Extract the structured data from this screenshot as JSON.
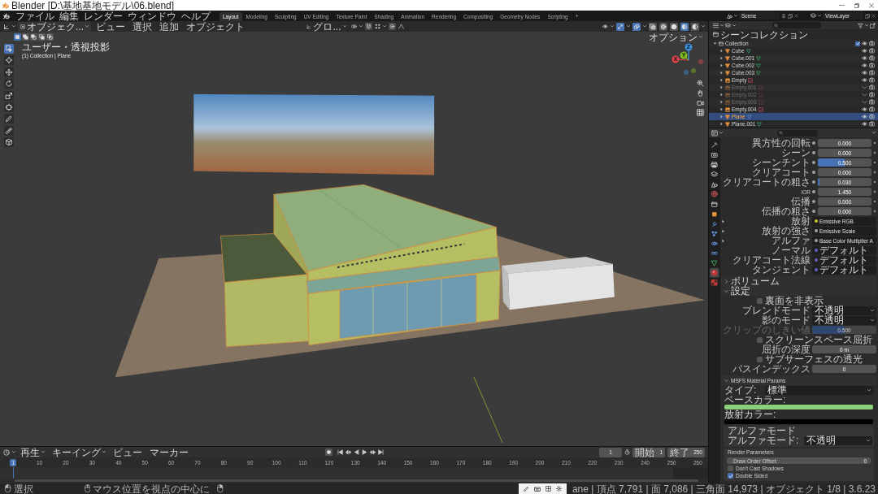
{
  "window": {
    "title": "Blender [D:\\基地基地モデル\\06.blend]"
  },
  "menu": [
    "ファイル",
    "編集",
    "レンダー",
    "ウィンドウ",
    "ヘルプ"
  ],
  "workspaces": [
    {
      "label": "Layout",
      "selected": true
    },
    {
      "label": "Modeling",
      "selected": false
    },
    {
      "label": "Sculpting",
      "selected": false
    },
    {
      "label": "UV Editing",
      "selected": false
    },
    {
      "label": "Texture Paint",
      "selected": false
    },
    {
      "label": "Shading",
      "selected": false
    },
    {
      "label": "Animation",
      "selected": false
    },
    {
      "label": "Rendering",
      "selected": false
    },
    {
      "label": "Compositing",
      "selected": false
    },
    {
      "label": "Geometry Nodes",
      "selected": false
    },
    {
      "label": "Scripting",
      "selected": false
    }
  ],
  "add_workspace": "+",
  "scene": {
    "scene_name": "Scene",
    "view_layer": "ViewLayer"
  },
  "viewport": {
    "mode": "オブジェク...",
    "menus": [
      "ビュー",
      "選択",
      "追加",
      "オブジェクト"
    ],
    "orientation": "グロ...",
    "toggles": [
      {
        "kind": "gizmo",
        "on": true
      },
      {
        "kind": "overlay",
        "on": true
      },
      {
        "kind": "xray",
        "on": false
      }
    ],
    "shading": [
      {
        "kind": "wireframe",
        "selected": false
      },
      {
        "kind": "solid",
        "selected": false
      },
      {
        "kind": "material",
        "selected": true
      },
      {
        "kind": "rendered",
        "selected": false
      }
    ],
    "selection_modes": [
      {
        "kind": "set",
        "selected": true
      },
      {
        "kind": "extend",
        "selected": false
      },
      {
        "kind": "subtract",
        "selected": false
      },
      {
        "kind": "invert",
        "selected": false
      },
      {
        "kind": "intersect",
        "selected": false
      }
    ],
    "options": "オプション",
    "view_name": "ユーザー・透視投影",
    "context": "(1) Collection | Plane",
    "tools": [
      {
        "kind": "select",
        "selected": true
      },
      {
        "kind": "cursor",
        "selected": false
      },
      {
        "kind": "move",
        "selected": false
      },
      {
        "kind": "rotate",
        "selected": false
      },
      {
        "kind": "scale",
        "selected": false
      },
      {
        "kind": "transform",
        "selected": false
      },
      {
        "kind": "annotate",
        "selected": false
      },
      {
        "kind": "measure",
        "selected": false
      },
      {
        "kind": "add_cube",
        "selected": false
      }
    ],
    "gizmo": [
      {
        "label": "X",
        "color": "#e0434f"
      },
      {
        "label": "Y",
        "color": "#7fb81e"
      },
      {
        "label": "Z",
        "color": "#3d8fe0"
      }
    ]
  },
  "outliner": {
    "root": "シーンコレクション",
    "items": [
      {
        "name": "Collection",
        "kind": "collection",
        "expanded": true,
        "checked": true,
        "selected": false,
        "visible": true,
        "children": [
          {
            "name": "Cube",
            "kind": "mesh",
            "expanded": false,
            "selected": false,
            "visible": true
          },
          {
            "name": "Cube.001",
            "kind": "mesh",
            "expanded": false,
            "selected": false,
            "visible": true
          },
          {
            "name": "Cube.002",
            "kind": "mesh",
            "expanded": false,
            "selected": false,
            "visible": true
          },
          {
            "name": "Cube.003",
            "kind": "mesh",
            "expanded": false,
            "selected": false,
            "visible": true
          },
          {
            "name": "Empty",
            "kind": "empty",
            "expanded": false,
            "selected": false,
            "visible": true
          },
          {
            "name": "Empty.001",
            "kind": "empty",
            "expanded": false,
            "selected": false,
            "visible": false
          },
          {
            "name": "Empty.002",
            "kind": "empty",
            "expanded": false,
            "selected": false,
            "visible": false
          },
          {
            "name": "Empty.003",
            "kind": "empty",
            "expanded": false,
            "selected": false,
            "visible": false
          },
          {
            "name": "Empty.004",
            "kind": "empty",
            "expanded": false,
            "selected": false,
            "visible": true
          },
          {
            "name": "Plane",
            "kind": "mesh",
            "expanded": false,
            "selected": true,
            "visible": true
          },
          {
            "name": "Plane.001",
            "kind": "mesh",
            "expanded": false,
            "selected": false,
            "visible": true
          }
        ]
      }
    ]
  },
  "properties": {
    "tabs": [
      {
        "kind": "tool",
        "selected": false
      },
      {
        "kind": "render",
        "selected": false
      },
      {
        "kind": "output",
        "selected": false
      },
      {
        "kind": "view_layer",
        "selected": false
      },
      {
        "kind": "scene",
        "selected": false
      },
      {
        "kind": "world",
        "selected": false
      },
      {
        "kind": "collection",
        "selected": false
      },
      {
        "kind": "object",
        "selected": false
      },
      {
        "kind": "modifiers",
        "selected": false
      },
      {
        "kind": "particles",
        "selected": false
      },
      {
        "kind": "physics",
        "selected": false
      },
      {
        "kind": "constraints",
        "selected": false
      },
      {
        "kind": "data",
        "selected": false
      },
      {
        "kind": "material",
        "selected": true
      },
      {
        "kind": "texture",
        "selected": false
      }
    ],
    "surface_rows": [
      {
        "kind": "factor",
        "label": "異方性の回転",
        "value": "0.000",
        "color": "#a1a1a1"
      },
      {
        "kind": "factor",
        "label": "シーン",
        "value": "0.000",
        "color": "#a1a1a1"
      },
      {
        "kind": "factor",
        "label": "シーンチント",
        "value": "0.500",
        "level": 0.5,
        "color": "#a1a1a1"
      },
      {
        "kind": "factor",
        "label": "クリアコート",
        "value": "0.000",
        "color": "#a1a1a1"
      },
      {
        "kind": "factor",
        "label": "クリアコートの粗さ",
        "value": "0.030",
        "level": 0.03,
        "color": "#a1a1a1"
      },
      {
        "kind": "number",
        "label": "IOR",
        "value": "1.450",
        "color": "#a1a1a1"
      },
      {
        "kind": "factor",
        "label": "伝播",
        "value": "0.000",
        "color": "#a1a1a1"
      },
      {
        "kind": "factor",
        "label": "伝播の粗さ",
        "value": "0.000",
        "color": "#a1a1a1"
      },
      {
        "kind": "node",
        "label": "放射",
        "value": "Emissive RGB",
        "expanded": false,
        "color": "#c7c729"
      },
      {
        "kind": "node",
        "label": "放射の強さ",
        "value": "Emissive Scale",
        "expanded": false,
        "color": "#a1a1a1"
      },
      {
        "kind": "node",
        "label": "アルファ",
        "value": "Base Color Multiplier A",
        "expanded": false,
        "color": "#a1a1a1"
      },
      {
        "kind": "vector",
        "label": "ノーマル",
        "value": "デフォルト",
        "color": "#6363c7"
      },
      {
        "kind": "vector",
        "label": "クリアコート法線",
        "value": "デフォルト",
        "color": "#6363c7"
      },
      {
        "kind": "vector",
        "label": "タンジェント",
        "value": "デフォルト",
        "color": "#6363c7"
      }
    ],
    "panels": [
      {
        "title": "ボリューム",
        "expanded": false
      },
      {
        "title": "設定",
        "expanded": true,
        "rows": [
          {
            "kind": "checkbox",
            "label": "裏面を非表示",
            "checked": false,
            "disabled": false
          },
          {
            "kind": "dropdown",
            "label": "ブレンドモード",
            "value": "不透明",
            "disabled": false
          },
          {
            "kind": "dropdown",
            "label": "影のモード",
            "value": "不透明",
            "disabled": false
          },
          {
            "kind": "slider",
            "label": "クリップのしきい値",
            "value": "0.500",
            "level": 0.5,
            "disabled": true
          },
          {
            "kind": "checkbox",
            "label": "スクリーンスペース屈折",
            "checked": false,
            "disabled": false
          },
          {
            "kind": "number",
            "label": "屈折の深度",
            "value": "0 m",
            "disabled": false
          },
          {
            "kind": "checkbox",
            "label": "サブサーフェスの透光",
            "checked": false,
            "disabled": false
          },
          {
            "kind": "number",
            "label": "パスインデックス",
            "value": "0",
            "disabled": false
          }
        ]
      }
    ],
    "msfs": {
      "title": "MSFS Material Params",
      "expanded": true,
      "type_label": "タイプ:",
      "type_value": "標準",
      "color_fields": [
        {
          "label": "ベースカラー:",
          "color": "#8cd17a"
        },
        {
          "label": "放射カラー:",
          "color": "#000000"
        }
      ],
      "alpha": {
        "title": "アルファモード",
        "label": "アルファモード:",
        "value": "不透明"
      },
      "render": {
        "title": "Render Parameters",
        "field_label": "Draw Order Offset:",
        "field_value": "0",
        "checks": [
          {
            "label": "Don't Cast Shadows",
            "checked": false
          },
          {
            "label": "Double Sided",
            "checked": true
          }
        ]
      }
    }
  },
  "timeline": {
    "menus": [
      {
        "label": "再生",
        "kind": "dropdown"
      },
      {
        "label": "キーイング",
        "kind": "dropdown"
      },
      {
        "label": "ビュー",
        "kind": "menu"
      },
      {
        "label": "マーカー",
        "kind": "menu"
      }
    ],
    "frame": "1",
    "start_label": "開始",
    "start": "1",
    "end_label": "終了",
    "end": "250",
    "playhead": "1",
    "ruler": [
      "10",
      "20",
      "30",
      "40",
      "50",
      "60",
      "70",
      "80",
      "90",
      "100",
      "110",
      "120",
      "130",
      "140",
      "150",
      "160",
      "170",
      "180",
      "190",
      "200",
      "210",
      "220",
      "230",
      "240",
      "250",
      "260"
    ]
  },
  "status_bar": {
    "hints": [
      {
        "kind": "left",
        "label": "選択"
      },
      {
        "kind": "middle",
        "label": "マウス位置を視点の中心に"
      },
      {
        "kind": "right"
      }
    ],
    "stats": "ane | 頂点 7,791 | 面 7,086 | 三角面 14,973 | オブジェクト 1/8 | 3.6.23"
  }
}
